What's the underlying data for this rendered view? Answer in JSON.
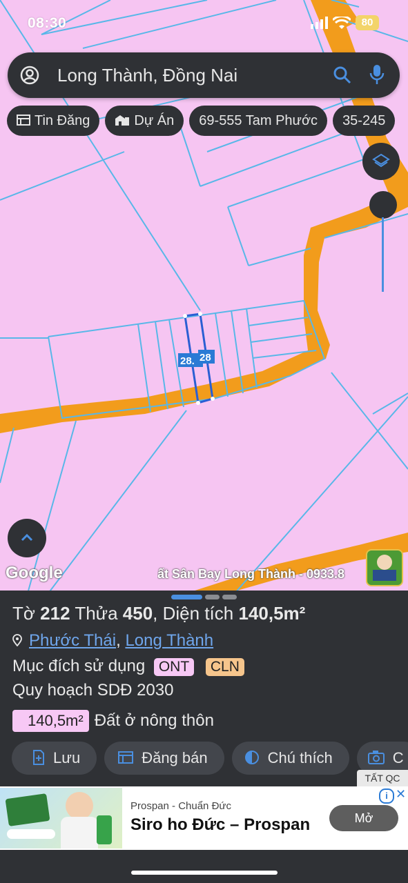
{
  "status_bar": {
    "time": "08:30",
    "battery": "80"
  },
  "search": {
    "text": "Long Thành, Đồng Nai"
  },
  "chips": [
    {
      "label": "Tin Đăng",
      "icon": "listing-icon"
    },
    {
      "label": "Dự Án",
      "icon": "building-icon"
    },
    {
      "label": "69-555 Tam Phước",
      "icon": ""
    },
    {
      "label": "35-245",
      "icon": ""
    }
  ],
  "map": {
    "parcel_labels": [
      "28.",
      "28"
    ],
    "google": "Google",
    "watermark": "ất Sân Bay Long Thành - 0933.8",
    "colors": {
      "land": "#f6c5f2",
      "road": "#f29c1c",
      "boundary": "#58b7e8"
    }
  },
  "info": {
    "to_label": "Tờ",
    "to_value": "212",
    "thua_label": "Thửa",
    "thua_value": "450",
    "dien_tich_label": ", Diện tích",
    "dien_tich_value": "140,5m²",
    "location_ward": "Phước Thái",
    "location_sep": ",",
    "location_district": "Long Thành",
    "purpose_label": "Mục đích sử dụng",
    "tags": [
      {
        "label": "ONT",
        "color": "#f7c8f5"
      },
      {
        "label": "CLN",
        "color": "#f6c58c"
      }
    ],
    "plan_label": "Quy hoạch SDĐ 2030",
    "area_value": "140,5m²",
    "area_desc": "Đất ở nông thôn"
  },
  "actions": [
    {
      "label": "Lưu",
      "icon": "bookmark-add-icon"
    },
    {
      "label": "Đăng bán",
      "icon": "post-sale-icon"
    },
    {
      "label": "Chú thích",
      "icon": "legend-icon"
    },
    {
      "label": "C",
      "icon": "camera-icon"
    }
  ],
  "ad": {
    "tag": "TẤT QC",
    "brand": "Prospan - Chuẩn Đức",
    "title": "Siro ho Đức – Prospan",
    "button": "Mở",
    "info": "i"
  }
}
